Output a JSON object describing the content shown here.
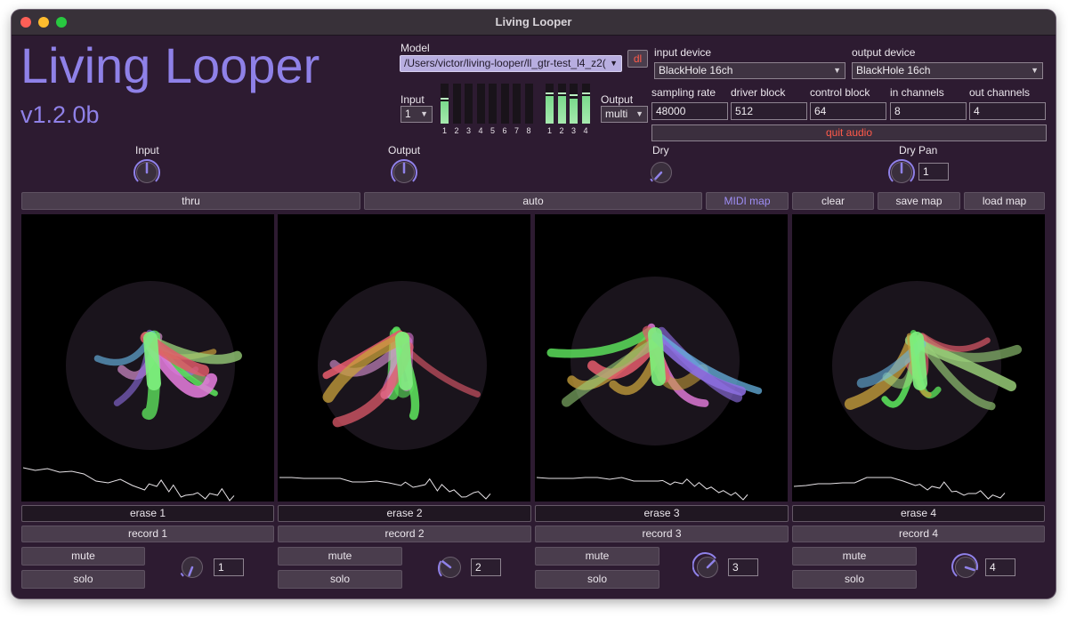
{
  "window": {
    "title": "Living Looper"
  },
  "app": {
    "title": "Living Looper",
    "version": "v1.2.0b"
  },
  "model": {
    "label": "Model",
    "path": "/Users/victor/living-looper/ll_gtr-test_l4_z2(",
    "download_label": "dl"
  },
  "io": {
    "input_label": "Input",
    "input_value": "1",
    "output_label": "Output",
    "output_value": "multi",
    "input_meters": [
      {
        "label": "1",
        "level": 0.55
      },
      {
        "label": "2",
        "level": 0
      },
      {
        "label": "3",
        "level": 0
      },
      {
        "label": "4",
        "level": 0
      },
      {
        "label": "5",
        "level": 0
      },
      {
        "label": "6",
        "level": 0
      },
      {
        "label": "7",
        "level": 0
      },
      {
        "label": "8",
        "level": 0
      }
    ],
    "output_meters": [
      {
        "label": "1",
        "level": 0.68
      },
      {
        "label": "2",
        "level": 0.68
      },
      {
        "label": "3",
        "level": 0.62
      },
      {
        "label": "4",
        "level": 0.68
      }
    ]
  },
  "audio": {
    "input_device_label": "input device",
    "input_device": "BlackHole 16ch",
    "output_device_label": "output device",
    "output_device": "BlackHole 16ch",
    "fields": [
      {
        "label": "sampling rate",
        "value": "48000"
      },
      {
        "label": "driver block",
        "value": "512"
      },
      {
        "label": "control block",
        "value": "64"
      },
      {
        "label": "in channels",
        "value": "8"
      },
      {
        "label": "out channels",
        "value": "4"
      }
    ],
    "quit_label": "quit audio"
  },
  "knobs": {
    "input_label": "Input",
    "output_label": "Output",
    "dry_label": "Dry",
    "dry_pan_label": "Dry Pan",
    "dry_pan_value": "1"
  },
  "controls": {
    "thru": "thru",
    "auto": "auto",
    "midi_map": "MIDI map",
    "clear": "clear",
    "save_map": "save map",
    "load_map": "load map"
  },
  "loops": [
    {
      "erase": "erase 1",
      "record": "record 1",
      "mute": "mute",
      "solo": "solo",
      "number": "1"
    },
    {
      "erase": "erase 2",
      "record": "record 2",
      "mute": "mute",
      "solo": "solo",
      "number": "2"
    },
    {
      "erase": "erase 3",
      "record": "record 3",
      "mute": "mute",
      "solo": "solo",
      "number": "3"
    },
    {
      "erase": "erase 4",
      "record": "record 4",
      "mute": "mute",
      "solo": "solo",
      "number": "4"
    }
  ],
  "colors": {
    "accent": "#8f81e8",
    "quit": "#ff5a4a",
    "background": "#2d1b31",
    "meter": "#8fe09d"
  }
}
